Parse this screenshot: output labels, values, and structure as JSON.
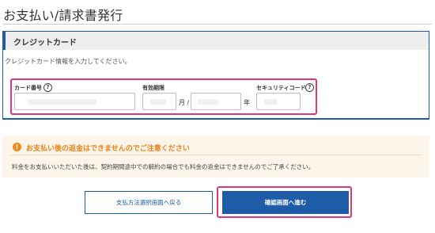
{
  "page": {
    "title": "お支払い/請求書発行"
  },
  "credit_card": {
    "section_title": "クレジットカード",
    "instructions": "クレジットカード情報を入力してください。",
    "card_number_label": "カード番号",
    "expiry_label": "有効期限",
    "month_unit": "月 /",
    "year_unit": "年",
    "security_code_label": "セキュリティコード",
    "help_glyph": "?"
  },
  "notice": {
    "icon_glyph": "!",
    "title": "お支払い後の返金はできませんのでご注意ください",
    "body": "料金をお支払いいただいた後は、契約期間途中での解約の場合でも料金の返金はできませんのでご了承ください。"
  },
  "actions": {
    "back_label": "支払方法選択画面へ戻る",
    "confirm_label": "確認画面へ進む"
  },
  "colors": {
    "accent_blue": "#1f5ca8",
    "highlight_pink": "#e0367a",
    "notice_orange": "#e98318",
    "notice_bg": "#fdf5e9"
  },
  "icons": {
    "help": "question-circle-icon",
    "notice": "exclamation-circle-icon"
  }
}
